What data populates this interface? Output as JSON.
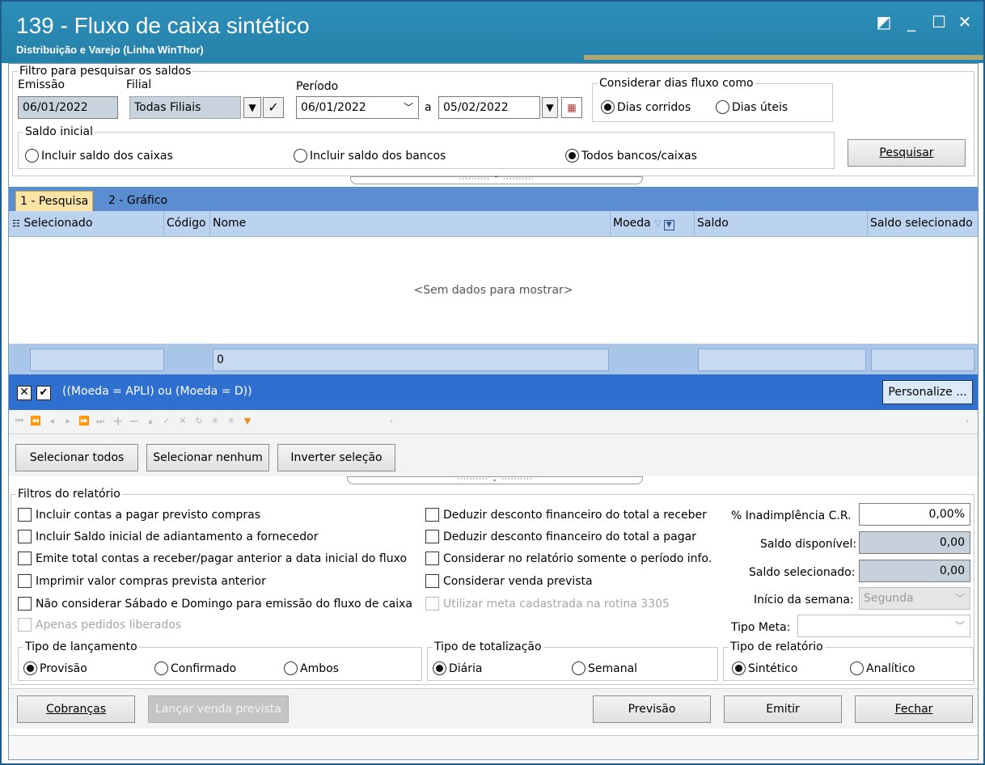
{
  "window": {
    "title": "139 - Fluxo de caixa sintético",
    "subtitle": "Distribuição e Varejo (Linha WinThor)",
    "controls": {
      "restore": "◩",
      "minimize": "_",
      "maximize": "☐",
      "close": "✕"
    }
  },
  "filter": {
    "legend": "Filtro para pesquisar os saldos",
    "emissao_label": "Emissão",
    "emissao_value": "06/01/2022",
    "filial_label": "Filial",
    "filial_value": "Todas Filiais",
    "periodo_label": "Período",
    "periodo_start": "06/01/2022",
    "periodo_sep": "a",
    "periodo_end": "05/02/2022",
    "dias_legend": "Considerar dias fluxo como",
    "dias_options": [
      "Dias corridos",
      "Dias úteis"
    ],
    "dias_selected": 0,
    "saldo_legend": "Saldo inicial",
    "saldo_options": [
      "Incluir saldo dos caixas",
      "Incluir saldo dos bancos",
      "Todos bancos/caixas"
    ],
    "saldo_selected": 2,
    "search_button": "Pesquisar"
  },
  "tabs": [
    "1 - Pesquisa",
    "2 - Gráfico"
  ],
  "grid": {
    "columns": [
      "Selecionado",
      "Código",
      "Nome",
      "Moeda",
      "Saldo",
      "Saldo selecionado"
    ],
    "empty_text": "<Sem dados para mostrar>",
    "footer_total": "0"
  },
  "filterbar": {
    "expression": "((Moeda = APLI) ou (Moeda = D))",
    "personalize": "Personalize ..."
  },
  "selection": {
    "select_all": "Selecionar todos",
    "select_none": "Selecionar nenhum",
    "invert": "Inverter seleção"
  },
  "report": {
    "legend": "Filtros do relatório",
    "checks_left": [
      "Incluir contas a pagar previsto compras",
      "Incluir Saldo inicial de adiantamento a fornecedor",
      "Emite total contas a receber/pagar anterior a data inicial do fluxo",
      "Imprimir valor compras prevista anterior",
      "Não considerar Sábado e Domingo para emissão do fluxo de caixa",
      "Apenas pedidos liberados"
    ],
    "checks_mid": [
      "Deduzir desconto financeiro do total a receber",
      "Deduzir desconto financeiro do total a pagar",
      "Considerar no relatório somente o período info.",
      "Considerar venda prevista",
      "Utilizar meta cadastrada na rotina 3305"
    ],
    "inadimplencia_label": "% Inadimplência C.R.",
    "inadimplencia_value": "0,00%",
    "saldo_disp_label": "Saldo disponível:",
    "saldo_disp_value": "0,00",
    "saldo_sel_label": "Saldo selecionado:",
    "saldo_sel_value": "0,00",
    "inicio_semana_label": "Início da semana:",
    "inicio_semana_value": "Segunda",
    "tipo_meta_label": "Tipo Meta:",
    "tipo_meta_value": "",
    "lancamento_legend": "Tipo de lançamento",
    "lancamento_options": [
      "Provisão",
      "Confirmado",
      "Ambos"
    ],
    "lancamento_selected": 0,
    "totalizacao_legend": "Tipo de totalização",
    "totalizacao_options": [
      "Diária",
      "Semanal"
    ],
    "totalizacao_selected": 0,
    "relatorio_legend": "Tipo de relatório",
    "relatorio_options": [
      "Sintético",
      "Analítico"
    ],
    "relatorio_selected": 0
  },
  "actions": {
    "cobrancas": "Cobranças",
    "lancar": "Lançar venda prevista",
    "previsao": "Previsão",
    "emitir": "Emitir",
    "fechar": "Fechar"
  },
  "status_text": ""
}
